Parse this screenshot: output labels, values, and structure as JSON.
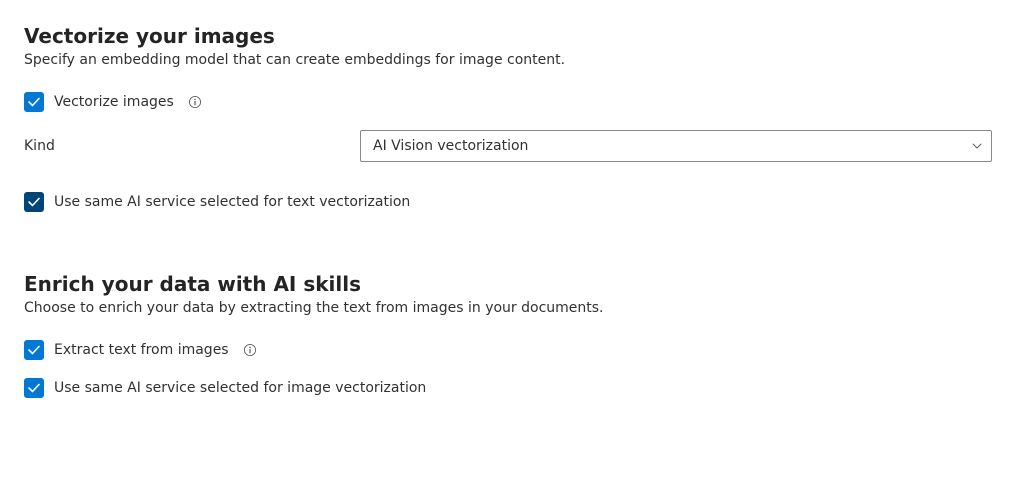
{
  "vectorize": {
    "title": "Vectorize your images",
    "desc": "Specify an embedding model that can create embeddings for image content.",
    "vectorize_images_label": "Vectorize images",
    "kind_label": "Kind",
    "kind_value": "AI Vision vectorization",
    "use_same_label": "Use same AI service selected for text vectorization"
  },
  "enrich": {
    "title": "Enrich your data with AI skills",
    "desc": "Choose to enrich your data by extracting the text from images in your documents.",
    "extract_label": "Extract text from images",
    "use_same_label": "Use same AI service selected for image vectorization"
  }
}
